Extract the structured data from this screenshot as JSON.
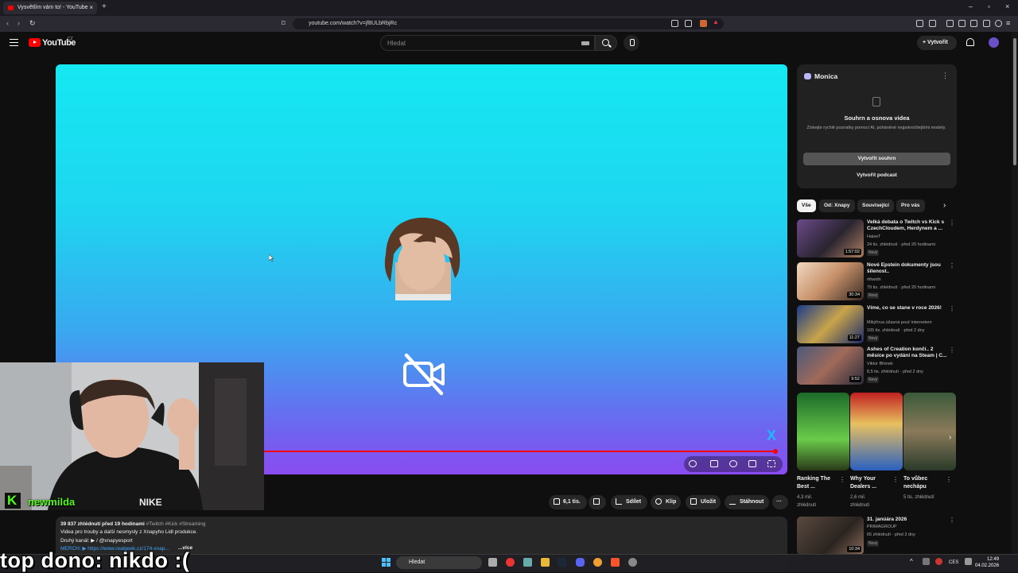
{
  "browser": {
    "tab_title": "Vysvětlím vám to! - YouTube",
    "url": "youtube.com/watch?v=jf8ULbRbjRc"
  },
  "header": {
    "logo_text": "YouTube",
    "country": "CZ",
    "search_placeholder": "Hledat",
    "create_label": "+ Vytvořit"
  },
  "video": {
    "x_mark": "X"
  },
  "webcam": {
    "name": "newmilda",
    "badge": "K"
  },
  "actions": {
    "likes": "6,1 tis.",
    "share": "Sdílet",
    "clip": "Klip",
    "save": "Uložit",
    "download": "Stáhnout",
    "more": "···"
  },
  "description": {
    "stats": "39 837 zhlédnutí  před 19 hodinami",
    "tags": "#Twitch #Kick #Streaming",
    "line1": "Videa pro trouby a další nesmysly z Xnapyho Lidl produkce.",
    "line2": "Druhý kanál:  ▶ / @xnapyesport",
    "line3": "MERCH: ▶ https://www.realgeek.cz/174-xnap...",
    "more": "...více"
  },
  "monica": {
    "title": "Monica",
    "heading": "Souhrn a osnova videa",
    "text": "Získejte rychlé poznatky pomocí AI, poháněné nejpokročilejšími modely.",
    "btn_summary": "Vytvořit souhrn",
    "btn_podcast": "Vytvořit podcast"
  },
  "chips": [
    "Vše",
    "Od: Xnapy",
    "Související",
    "Pro vás"
  ],
  "recommendations": [
    {
      "title": "Velká debata o Twitch vs Kick s CzechCloudem, Herdynem a ...",
      "channel": "HaiseT",
      "meta": "24 tis. zhlédnutí · před 20 hodinami",
      "badge": "Nový",
      "duration": "1:57:02"
    },
    {
      "title": "Nové Epstein dokumenty jsou šílenost..",
      "channel": "rthwidn",
      "meta": "79 tis. zhlédnutí · před 20 hodinami",
      "badge": "Nový",
      "duration": "30:34"
    },
    {
      "title": "Víme, co se stane v roce 2026!",
      "channel": "Mikýřova úžasná pouť internetem",
      "meta": "105 tis. zhlédnutí · před 2 dny",
      "badge": "Nový",
      "duration": "11:27"
    },
    {
      "title": "Ashes of Creation končí.. 2 měsíce po vydání na Steam | C...",
      "channel": "Viktor Břenek",
      "meta": "8,5 tis. zhlédnutí · před 2 dny",
      "badge": "Nový",
      "duration": "9:52"
    },
    {
      "title": "31. janúára 2026",
      "channel": "PRIMAGROUP",
      "meta": "65 zhlédnutí · před 3 dny",
      "badge": "Nový",
      "duration": "10:34"
    }
  ],
  "shorts": [
    {
      "title": "Ranking The Best ...",
      "views": "4,3 mil. zhlédnutí"
    },
    {
      "title": "Why Your Dealers ...",
      "views": "2,6 mil. zhlédnutí"
    },
    {
      "title": "To vůbec nechápu",
      "views": "5 tis. zhlédnutí"
    }
  ],
  "overlay": {
    "top_dono": "top dono: nikdo :("
  },
  "taskbar": {
    "search": "Hledat",
    "lang": "CES",
    "time": "12:49",
    "date": "04.02.2026"
  }
}
